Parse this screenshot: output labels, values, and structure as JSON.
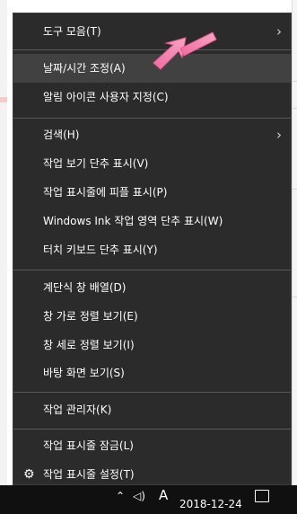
{
  "menu": {
    "items": [
      {
        "label": "도구 모음(T)",
        "submenu": true
      },
      {
        "label": "날짜/시간 조정(A)",
        "highlighted": true
      },
      {
        "label": "알림 아이콘 사용자 지정(C)"
      },
      {
        "label": "검색(H)",
        "submenu": true
      },
      {
        "label": "작업 보기 단추 표시(V)"
      },
      {
        "label": "작업 표시줄에 피플 표시(P)"
      },
      {
        "label": "Windows Ink 작업 영역 단추 표시(W)"
      },
      {
        "label": "터치 키보드 단추 표시(Y)"
      },
      {
        "label": "계단식 창 배열(D)"
      },
      {
        "label": "창 가로 정렬 보기(E)"
      },
      {
        "label": "창 세로 정렬 보기(I)"
      },
      {
        "label": "바탕 화면 보기(S)"
      },
      {
        "label": "작업 관리자(K)"
      },
      {
        "label": "작업 표시줄 잠금(L)"
      },
      {
        "label": "작업 표시줄 설정(T)",
        "icon": "gear-icon"
      }
    ]
  },
  "taskbar": {
    "date": "2018-12-24",
    "ime_indicator": "A"
  },
  "colors": {
    "menu_bg": "#2b2b2b",
    "highlight_bg": "#414141",
    "annotation_arrow": "#f06aa0"
  }
}
